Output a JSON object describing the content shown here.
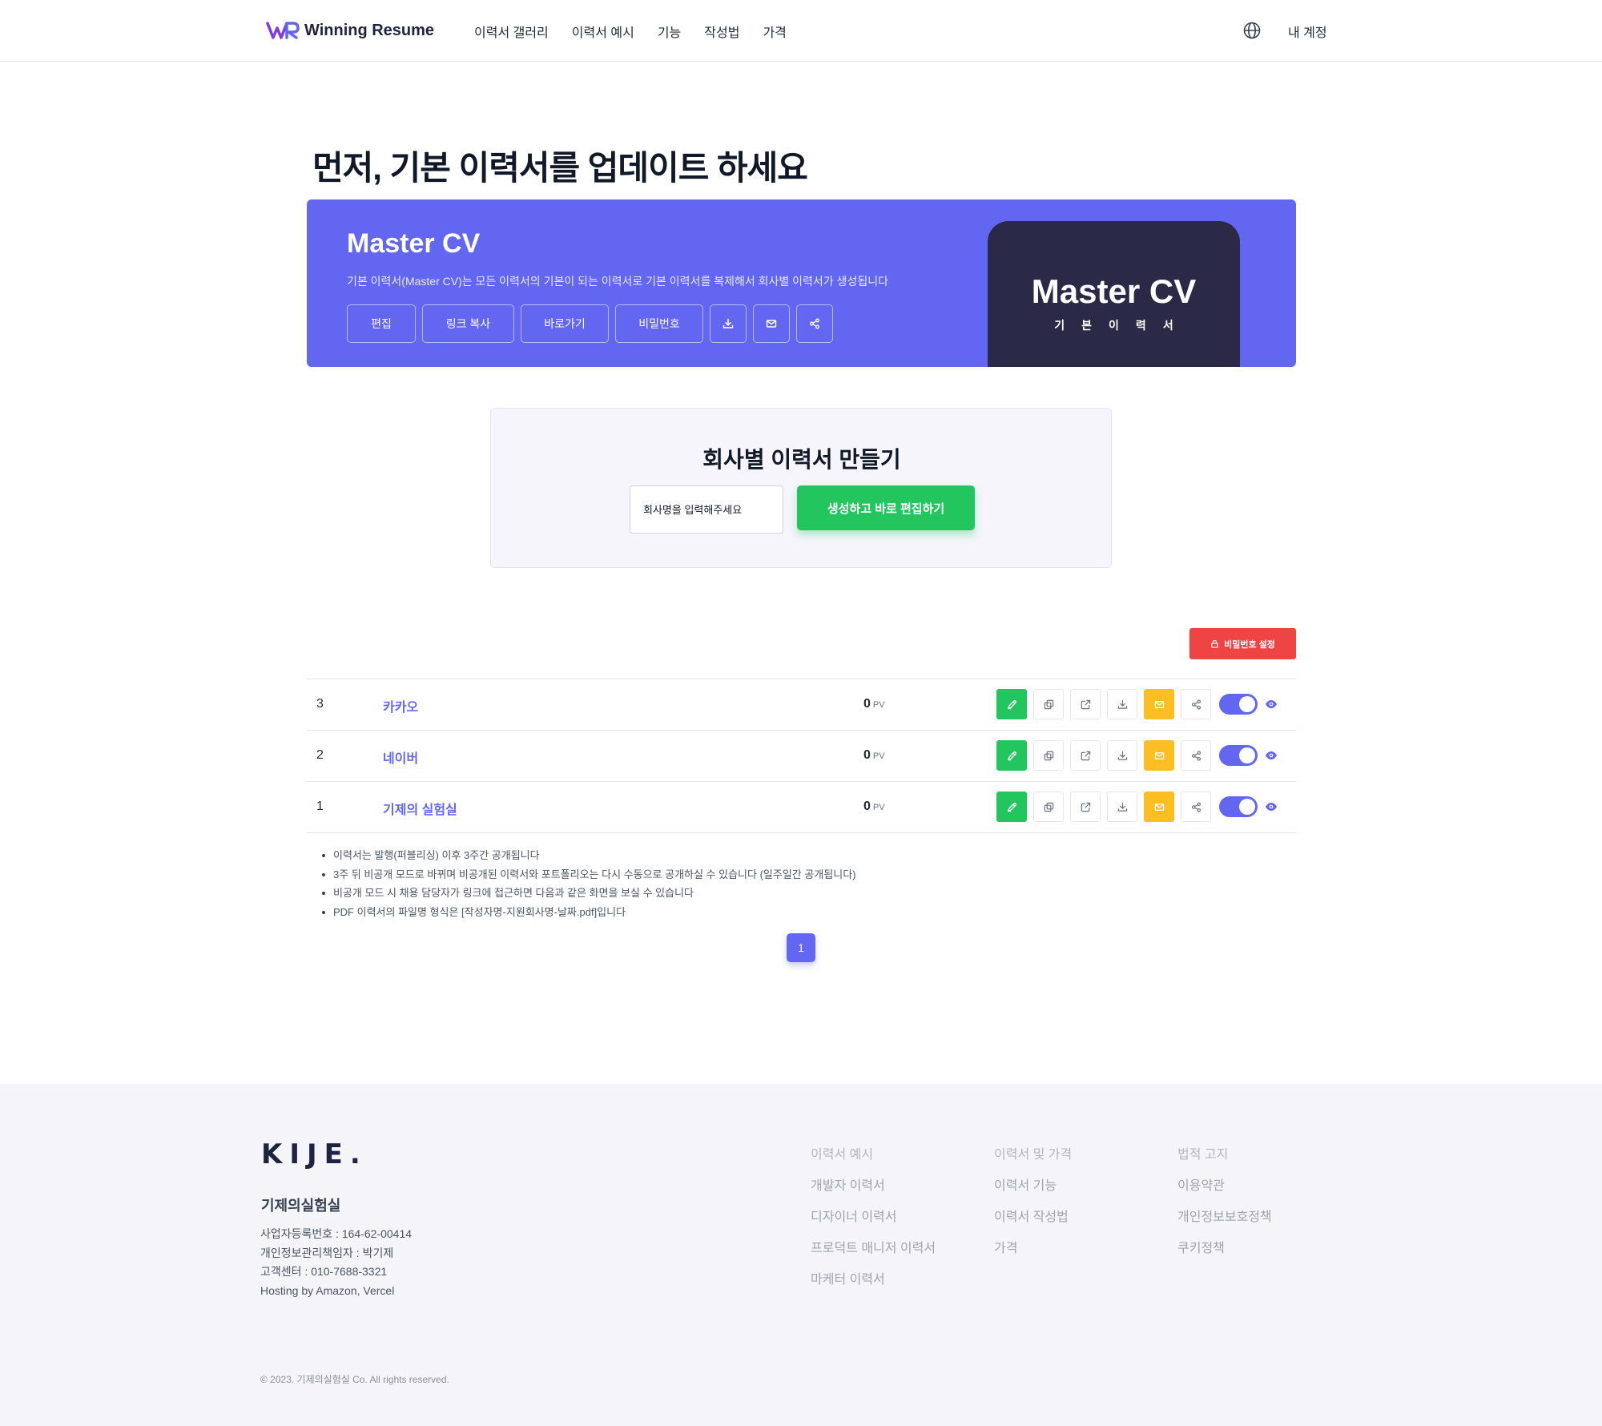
{
  "nav": {
    "brand": "Winning Resume",
    "links": [
      "이력서 갤러리",
      "이력서 예시",
      "기능",
      "작성법",
      "가격"
    ],
    "account": "내 계정"
  },
  "headline": "먼저, 기본 이력서를 업데이트 하세요",
  "master_cv": {
    "title": "Master CV",
    "description": "기본 이력서(Master CV)는 모든 이력서의 기본이 되는 이력서로 기본 이력서를 복제해서 회사별 이력서가 생성됩니다",
    "buttons": {
      "edit": "편집",
      "copy_link": "링크 복사",
      "goto": "바로가기",
      "password": "비밀번호"
    },
    "card_title": "Master CV",
    "card_subtitle": "기본이력서"
  },
  "create": {
    "title": "회사별 이력서 만들기",
    "placeholder": "회사명을 입력해주세요",
    "button": "생성하고 바로 편집하기"
  },
  "password_setting": "비밀번호 설정",
  "resumes": [
    {
      "num": "3",
      "name": "카카오",
      "pv": "0",
      "pv_unit": "PV"
    },
    {
      "num": "2",
      "name": "네이버",
      "pv": "0",
      "pv_unit": "PV"
    },
    {
      "num": "1",
      "name": "기제의 실험실",
      "pv": "0",
      "pv_unit": "PV"
    }
  ],
  "notes": [
    "이력서는 발행(퍼블리싱) 이후 3주간 공개됩니다",
    "3주 뒤 비공개 모드로 바뀌며 비공개된 이력서와 포트폴리오는 다시 수동으로 공개하실 수 있습니다 (일주일간 공개됩니다)",
    "비공개 모드 시 채용 담당자가 링크에 접근하면 다음과 같은 화면을 보실 수 있습니다",
    "PDF 이력서의 파일명 형식은 [작성자명-지원회사명-날짜.pdf]입니다"
  ],
  "pagination": {
    "current": "1"
  },
  "footer": {
    "logo": "KIJE.",
    "company": "기제의실험실",
    "info": [
      "사업자등록번호 : 164-62-00414",
      "개인정보관리책임자 : 박기제",
      "고객센터 : 010-7688-3321",
      "Hosting by Amazon, Vercel"
    ],
    "col1": {
      "head": "이력서 예시",
      "items": [
        "개발자 이력서",
        "디자이너 이력서",
        "프로덕트 매니저 이력서",
        "마케터 이력서"
      ]
    },
    "col2": {
      "head": "이력서 및 가격",
      "items": [
        "이력서 기능",
        "이력서 작성법",
        "가격"
      ]
    },
    "col3": {
      "head": "법적 고지",
      "items": [
        "이용약관",
        "개인정보보호정책",
        "쿠키정책"
      ]
    },
    "copyright": "© 2023. 기제의실험실 Co. All rights reserved."
  },
  "colors": {
    "primary": "#6366f1",
    "dark_card": "#2a2a48",
    "green": "#22c55e",
    "yellow": "#fbbf24",
    "red": "#ef4444",
    "footer_bg": "#f4f4f9"
  },
  "icons": {
    "row_actions": [
      "pencil-icon",
      "copy-icon",
      "external-link-icon",
      "download-icon",
      "mail-icon",
      "share-icon",
      "toggle",
      "eye-icon"
    ],
    "banner_icons": [
      "download-icon",
      "mail-icon",
      "share-icon"
    ],
    "nav": [
      "globe-icon"
    ]
  }
}
